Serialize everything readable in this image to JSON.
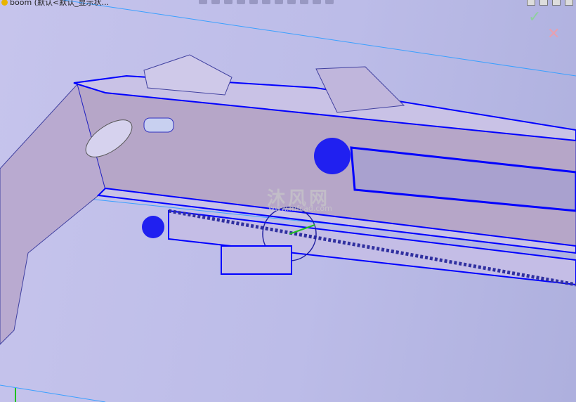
{
  "window": {
    "title": "boom (默认<默认_显示状..."
  },
  "toolbar": {
    "icons": [
      "zoom-to-fit-icon",
      "zoom-area-icon",
      "previous-view-icon",
      "section-view-icon",
      "dynamic-annotation-icon",
      "view-orientation-icon",
      "display-style-icon",
      "hide-show-icon",
      "edit-appearance-icon",
      "apply-scene-icon",
      "view-settings-icon"
    ]
  },
  "confirm": {
    "ok": "✓",
    "cancel": "✕"
  },
  "watermark": {
    "text": "沐风网",
    "url": "www.mfcad.com"
  },
  "colors": {
    "background": "#c4c3ec",
    "edge": "#0000ff",
    "face": "#b5a8d0",
    "sketch_line": "#3aa0ff"
  }
}
